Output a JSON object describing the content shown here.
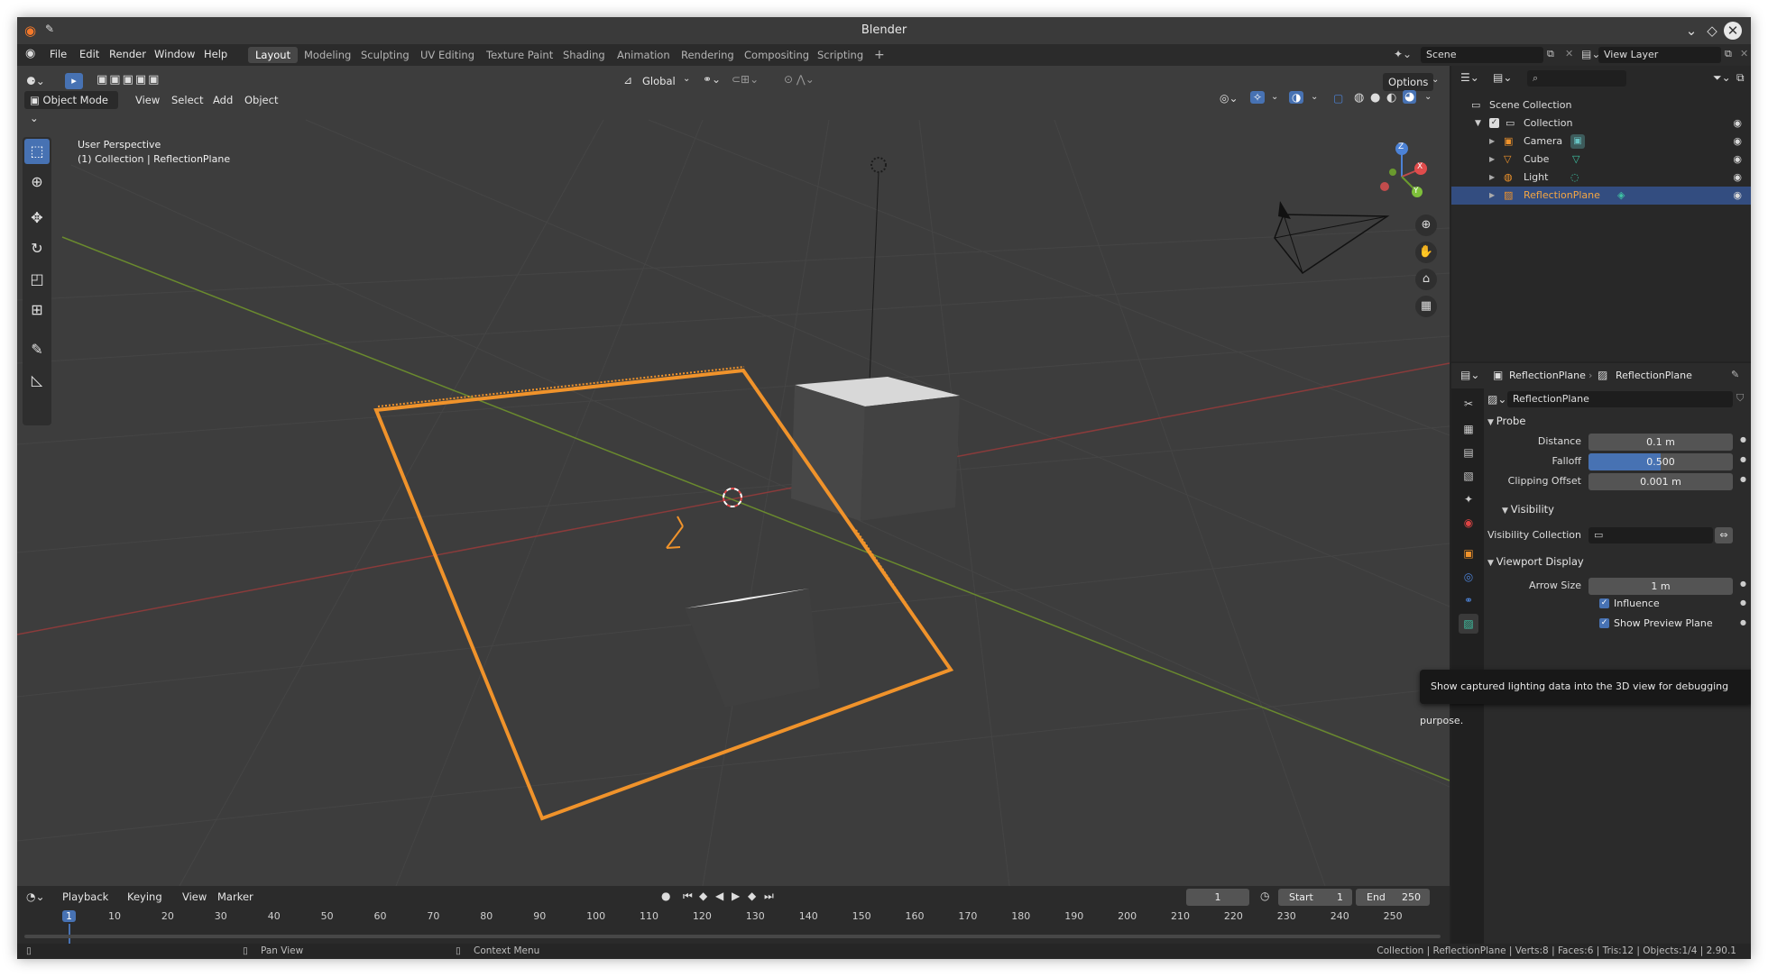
{
  "window": {
    "title": "Blender"
  },
  "menus": [
    "File",
    "Edit",
    "Render",
    "Window",
    "Help"
  ],
  "workspaces": [
    {
      "label": "Layout",
      "active": true
    },
    {
      "label": "Modeling"
    },
    {
      "label": "Sculpting"
    },
    {
      "label": "UV Editing"
    },
    {
      "label": "Texture Paint"
    },
    {
      "label": "Shading"
    },
    {
      "label": "Animation"
    },
    {
      "label": "Rendering"
    },
    {
      "label": "Compositing"
    },
    {
      "label": "Scripting"
    }
  ],
  "add_workspace": "+",
  "scene": {
    "name": "Scene",
    "view_layer": "View Layer"
  },
  "viewport": {
    "transform_orientation": "Global",
    "options_label": "Options",
    "mode": "Object Mode",
    "header_menus": [
      "View",
      "Select",
      "Add",
      "Object"
    ],
    "overlay_title": "User Perspective",
    "overlay_subtitle": "(1) Collection | ReflectionPlane",
    "gizmo": {
      "z": "Z",
      "y": "Y",
      "x": "X"
    }
  },
  "outliner": {
    "search_placeholder": "",
    "rows": [
      {
        "label": "Scene Collection",
        "level": 0
      },
      {
        "label": "Collection",
        "level": 1
      },
      {
        "label": "Camera",
        "level": 2
      },
      {
        "label": "Cube",
        "level": 2
      },
      {
        "label": "Light",
        "level": 2
      },
      {
        "label": "ReflectionPlane",
        "level": 2,
        "selected": true
      }
    ]
  },
  "properties": {
    "object_name": "ReflectionPlane",
    "data_name": "ReflectionPlane",
    "datablock_field": "ReflectionPlane",
    "probe_section": "Probe",
    "fields": [
      {
        "label": "Distance",
        "value": "0.1 m"
      },
      {
        "label": "Falloff",
        "value": "0.500",
        "fill": 0.5
      },
      {
        "label": "Clipping Offset",
        "value": "0.001 m"
      }
    ],
    "visibility_section": "Visibility",
    "visibility_collection_label": "Visibility Collection",
    "viewport_display_section": "Viewport Display",
    "arrow_size_label": "Arrow Size",
    "arrow_size_value": "1 m",
    "influence_label": "Influence",
    "influence_checked": true,
    "show_preview_plane_label": "Show Preview Plane",
    "show_preview_plane_checked": true
  },
  "tooltip": "Show captured lighting data into the 3D view for debugging purpose.",
  "timeline": {
    "menus": [
      "Playback",
      "Keying",
      "View",
      "Marker"
    ],
    "current_frame": "1",
    "start_label": "Start",
    "start_value": "1",
    "end_label": "End",
    "end_value": "250",
    "ticks": [
      "1",
      "10",
      "20",
      "30",
      "40",
      "50",
      "60",
      "70",
      "80",
      "90",
      "100",
      "110",
      "120",
      "130",
      "140",
      "150",
      "160",
      "170",
      "180",
      "190",
      "200",
      "210",
      "220",
      "230",
      "240",
      "250"
    ]
  },
  "statusbar": {
    "pan_view": "Pan View",
    "context_menu": "Context Menu",
    "stats": "Collection | ReflectionPlane | Verts:8 | Faces:6 | Tris:12 | Objects:1/4 | 2.90.1"
  },
  "colors": {
    "accent": "#4772b3",
    "selection_orange": "#f0932b",
    "bg_viewport": "#3d3d3d"
  }
}
